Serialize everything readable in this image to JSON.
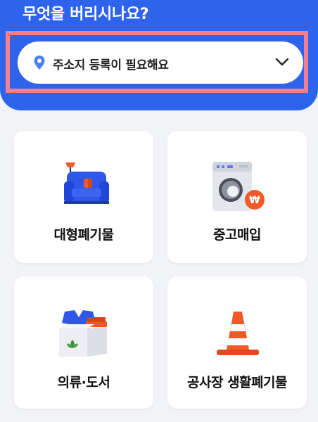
{
  "header": {
    "title": "무엇을 버리시나요?"
  },
  "address": {
    "text": "주소지 등록이 필요해요",
    "icons": [
      "location-pin-icon",
      "chevron-down-icon"
    ]
  },
  "categories": [
    {
      "label": "대형폐기물",
      "icon": "armchair-lamp-icon"
    },
    {
      "label": "중고매입",
      "icon": "washing-machine-won-icon",
      "badge": "₩"
    },
    {
      "label": "의류·도서",
      "icon": "clothes-box-icon"
    },
    {
      "label": "공사장 생활폐기물",
      "icon": "traffic-cone-icon"
    }
  ],
  "colors": {
    "header_bg": "#2e63ec",
    "highlight": "#f28090",
    "page_bg": "#f2f3f6"
  }
}
